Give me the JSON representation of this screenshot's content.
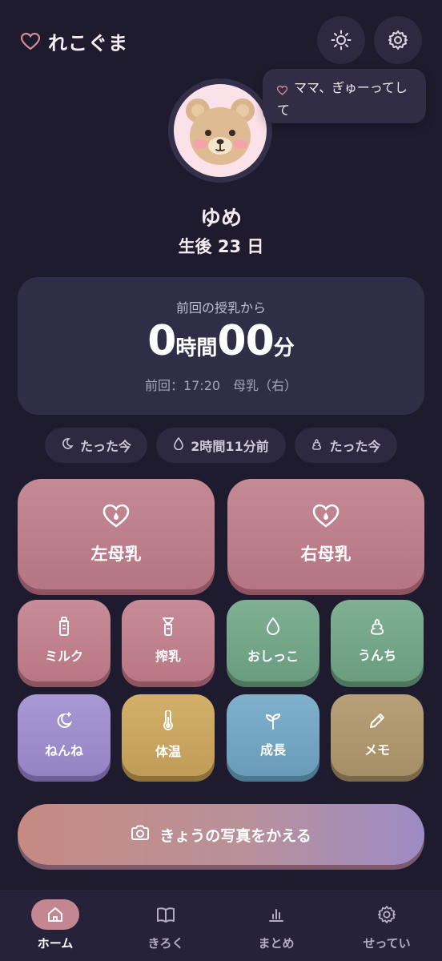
{
  "header": {
    "app_name": "れこぐま",
    "icons": [
      "heart-icon",
      "sun-icon",
      "gear-icon"
    ]
  },
  "bubble": {
    "message": "ママ、ぎゅーってして"
  },
  "baby": {
    "name": "ゆめ",
    "age_label": "生後 23 日"
  },
  "feed_card": {
    "label": "前回の授乳から",
    "hours": "0",
    "hours_unit": "時間",
    "minutes": "00",
    "minutes_unit": "分",
    "last": "前回：17:20　母乳（右）"
  },
  "chips": [
    {
      "icon": "moon-icon",
      "label": "たった今"
    },
    {
      "icon": "drop-icon",
      "label": "2時間11分前"
    },
    {
      "icon": "poop-icon",
      "label": "たった今"
    }
  ],
  "big_buttons": [
    {
      "icon": "heart-drop-icon",
      "label": "左母乳"
    },
    {
      "icon": "heart-drop-icon",
      "label": "右母乳"
    }
  ],
  "grid_buttons": [
    {
      "icon": "bottle-icon",
      "label": "ミルク",
      "color": "#c78c98"
    },
    {
      "icon": "pump-icon",
      "label": "搾乳",
      "color": "#c78c98"
    },
    {
      "icon": "drop-icon",
      "label": "おしっこ",
      "color": "#7fb093"
    },
    {
      "icon": "poop-icon",
      "label": "うんち",
      "color": "#7fb093"
    },
    {
      "icon": "moon-icon",
      "label": "ねんね",
      "color": "#a898d4"
    },
    {
      "icon": "thermometer-icon",
      "label": "体温",
      "color": "#d2b06a"
    },
    {
      "icon": "sprout-icon",
      "label": "成長",
      "color": "#7fb0cc"
    },
    {
      "icon": "pencil-icon",
      "label": "メモ",
      "color": "#b79f78"
    }
  ],
  "photo_button": {
    "icon": "camera-icon",
    "label": "きょうの写真をかえる"
  },
  "nav": [
    {
      "icon": "home-icon",
      "label": "ホーム",
      "active": true
    },
    {
      "icon": "book-icon",
      "label": "きろく",
      "active": false
    },
    {
      "icon": "bar-chart-icon",
      "label": "まとめ",
      "active": false
    },
    {
      "icon": "gear-icon",
      "label": "せってい",
      "active": false
    }
  ],
  "colors": {
    "background": "#1e1b2e",
    "card": "#302d47",
    "accent_pink": "#c48792"
  }
}
